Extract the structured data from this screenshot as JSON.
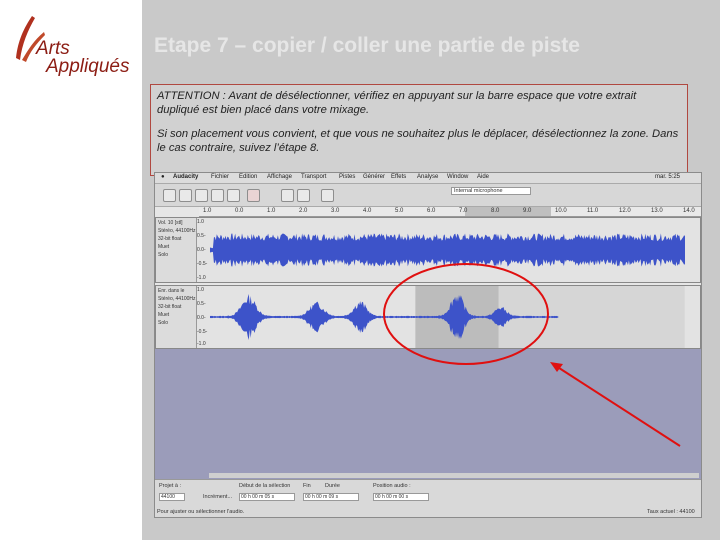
{
  "logo": {
    "line1": "Arts",
    "line2": "Appliqués"
  },
  "slide": {
    "title": "Etape 7 – copier / coller une partie de piste",
    "note_p1": "ATTENTION : Avant de désélectionner, vérifiez en appuyant sur la barre espace que votre extrait dupliqué est bien placé dans votre mixage.",
    "note_p2": "Si son placement vous convient, et que vous ne souhaitez plus le déplacer, désélectionnez la zone. Dans le cas contraire, suivez l’étape 8."
  },
  "app": {
    "menu": [
      "Audacity",
      "Fichier",
      "Edition",
      "Affichage",
      "Transport",
      "Pistes",
      "Générer",
      "Effets",
      "Analyse",
      "Window",
      "Aide"
    ],
    "status_right": "mar. 5:25",
    "input_device": "Internal microphone",
    "ruler_ticks": [
      "1.0",
      "0.0",
      "1.0",
      "2.0",
      "3.0",
      "4.0",
      "5.0",
      "6.0",
      "7.0",
      "8.0",
      "9.0",
      "10.0",
      "11.0",
      "12.0",
      "13.0",
      "14.0"
    ],
    "track1": {
      "name": "Vol. 10 [stl]",
      "info1": "Stéréo, 44100Hz",
      "info2": "32-bit float",
      "btn_mute": "Muet",
      "btn_solo": "Solo"
    },
    "track2": {
      "name": "Enr. dans le",
      "info1": "Stéréo, 44100Hz",
      "info2": "32-bit float",
      "btn_mute": "Muet",
      "btn_solo": "Solo"
    },
    "y_labels": [
      "1.0",
      "0.5-",
      "0.0-",
      "-0.5-",
      "-1.0"
    ],
    "bottom": {
      "project_rate_label": "Projet à :",
      "project_rate_value": "44100",
      "snap_label": "Incrément...",
      "selection_start_label": "Début de la sélection",
      "end_label": "Fin",
      "length_label": "Durée",
      "audio_position_label": "Position audio :",
      "time1": "00 h 00 m 05 s",
      "time2": "00 h 00 m 09 s",
      "time3": "00 h 00 m 00 s",
      "status": "Pour ajuster ou sélectionner l'audio.",
      "rate_status": "Taux actuel : 44100"
    }
  }
}
